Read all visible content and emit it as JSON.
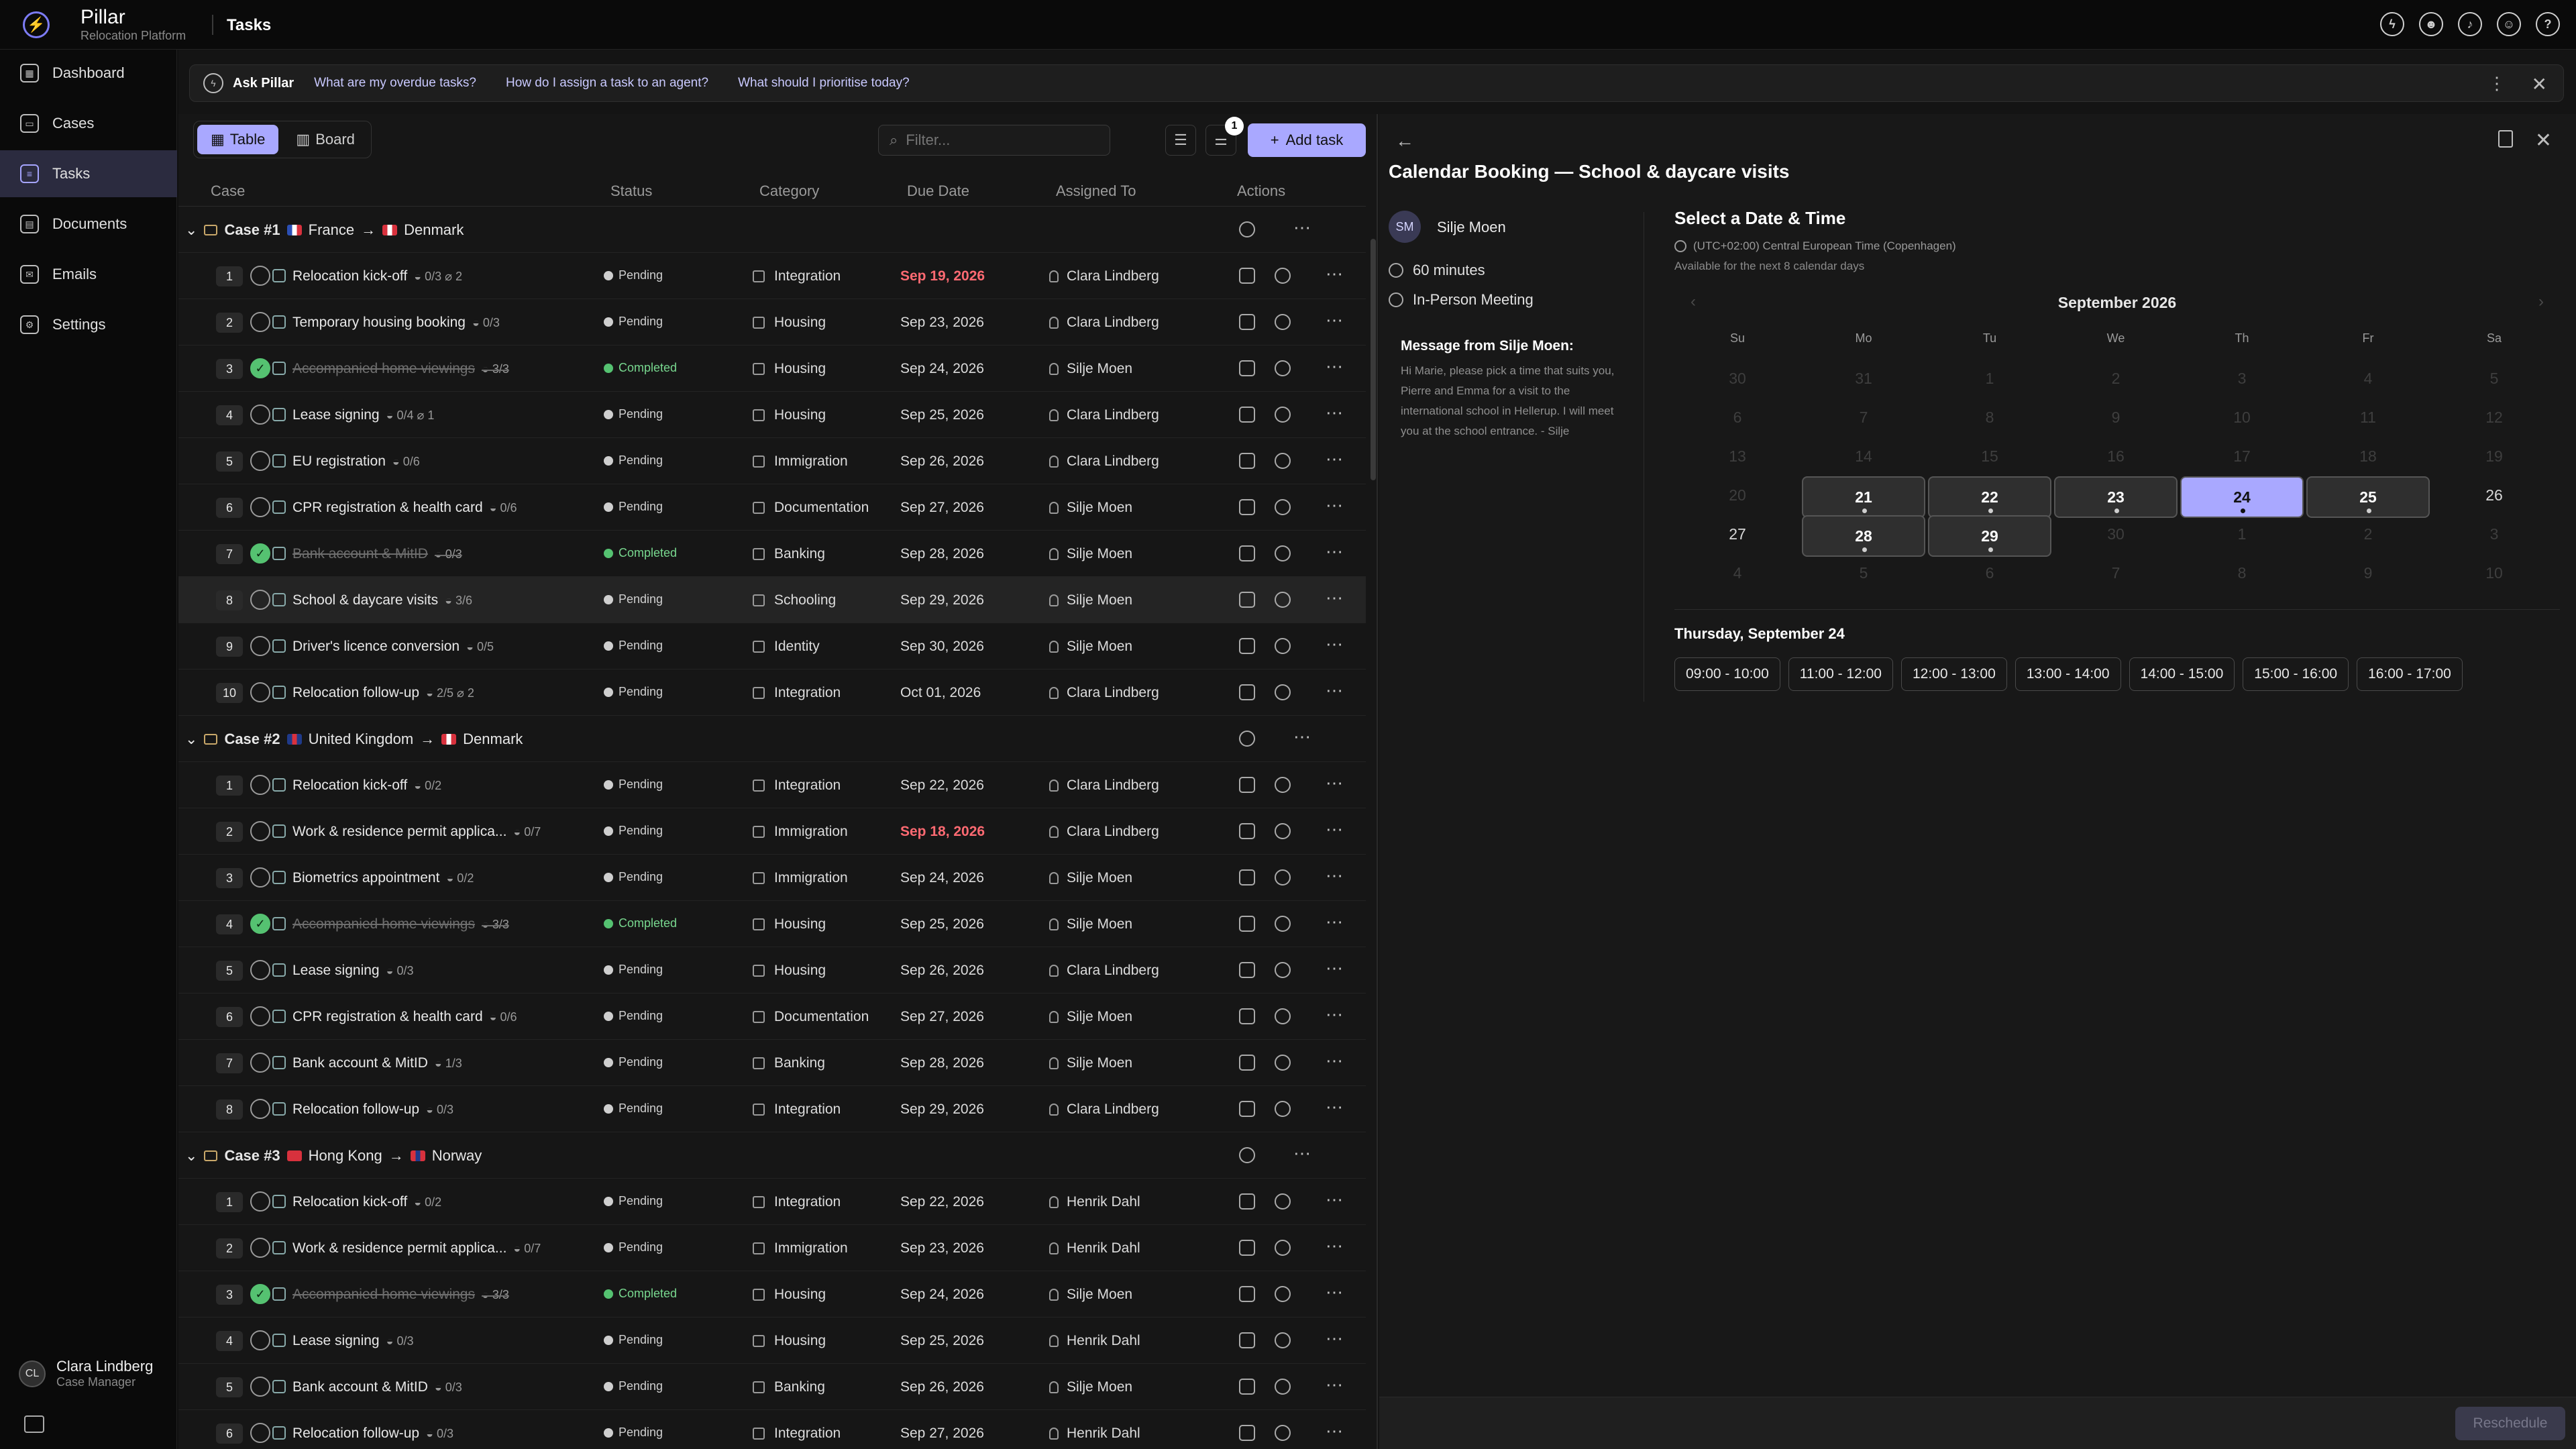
{
  "app": {
    "name": "Pillar",
    "subtitle": "Relocation Platform",
    "page_title": "Tasks"
  },
  "topbar_icons": [
    "bolt-icon",
    "user-gear-icon",
    "bell-icon",
    "smiley-icon",
    "help-icon"
  ],
  "sidebar": {
    "items": [
      {
        "label": "Dashboard",
        "icon": "dashboard-icon"
      },
      {
        "label": "Cases",
        "icon": "briefcase-icon"
      },
      {
        "label": "Tasks",
        "icon": "tasks-icon",
        "active": true
      },
      {
        "label": "Documents",
        "icon": "document-icon"
      },
      {
        "label": "Emails",
        "icon": "mail-icon"
      },
      {
        "label": "Settings",
        "icon": "gear-icon"
      }
    ],
    "user": {
      "initials": "CL",
      "name": "Clara Lindberg",
      "role": "Case Manager"
    }
  },
  "ask": {
    "label": "Ask Pillar",
    "suggestions": [
      "What are my overdue tasks?",
      "How do I assign a task to an agent?",
      "What should I prioritise today?"
    ]
  },
  "toolbar": {
    "table": "Table",
    "board": "Board",
    "filter_placeholder": "Filter...",
    "filter_count": "1",
    "add_task": "Add task"
  },
  "columns": {
    "case": "Case",
    "status": "Status",
    "category": "Category",
    "due": "Due Date",
    "assigned": "Assigned To",
    "actions": "Actions"
  },
  "cases": [
    {
      "label": "Case #1",
      "from": "France",
      "to": "Denmark",
      "from_colors": [
        "#2b4fb5",
        "#ffffff",
        "#d8313d"
      ],
      "to_colors": [
        "#d8313d",
        "#ffffff",
        "#d8313d"
      ],
      "tasks": [
        {
          "n": "1",
          "name": "Relocation kick-off",
          "meta": "◒ 0/3 ⌀ 2",
          "status": "Pending",
          "category": "Integration",
          "due": "Sep 19, 2026",
          "overdue": true,
          "assignee": "Clara Lindberg"
        },
        {
          "n": "2",
          "name": "Temporary housing booking",
          "meta": "◒ 0/3",
          "status": "Pending",
          "category": "Housing",
          "due": "Sep 23, 2026",
          "assignee": "Clara Lindberg"
        },
        {
          "n": "3",
          "name": "Accompanied home viewings",
          "meta": "◒ 3/3",
          "status": "Completed",
          "category": "Housing",
          "due": "Sep 24, 2026",
          "assignee": "Silje Moen",
          "done": true
        },
        {
          "n": "4",
          "name": "Lease signing",
          "meta": "◒ 0/4 ⌀ 1",
          "status": "Pending",
          "category": "Housing",
          "due": "Sep 25, 2026",
          "assignee": "Clara Lindberg"
        },
        {
          "n": "5",
          "name": "EU registration",
          "meta": "◒ 0/6",
          "status": "Pending",
          "category": "Immigration",
          "due": "Sep 26, 2026",
          "assignee": "Clara Lindberg"
        },
        {
          "n": "6",
          "name": "CPR registration & health card",
          "meta": "◒ 0/6",
          "status": "Pending",
          "category": "Documentation",
          "due": "Sep 27, 2026",
          "assignee": "Silje Moen"
        },
        {
          "n": "7",
          "name": "Bank account & MitID",
          "meta": "◒ 0/3",
          "status": "Completed",
          "category": "Banking",
          "due": "Sep 28, 2026",
          "assignee": "Silje Moen",
          "done": true
        },
        {
          "n": "8",
          "name": "School & daycare visits",
          "meta": "◒ 3/6",
          "status": "Pending",
          "category": "Schooling",
          "due": "Sep 29, 2026",
          "assignee": "Silje Moen",
          "selected": true
        },
        {
          "n": "9",
          "name": "Driver's licence conversion",
          "meta": "◒ 0/5",
          "status": "Pending",
          "category": "Identity",
          "due": "Sep 30, 2026",
          "assignee": "Silje Moen"
        },
        {
          "n": "10",
          "name": "Relocation follow-up",
          "meta": "◒ 2/5 ⌀ 2",
          "status": "Pending",
          "category": "Integration",
          "due": "Oct 01, 2026",
          "assignee": "Clara Lindberg"
        }
      ]
    },
    {
      "label": "Case #2",
      "from": "United Kingdom",
      "to": "Denmark",
      "from_colors": [
        "#1f3a8a",
        "#d8313d",
        "#1f3a8a"
      ],
      "to_colors": [
        "#d8313d",
        "#ffffff",
        "#d8313d"
      ],
      "tasks": [
        {
          "n": "1",
          "name": "Relocation kick-off",
          "meta": "◒ 0/2",
          "status": "Pending",
          "category": "Integration",
          "due": "Sep 22, 2026",
          "assignee": "Clara Lindberg"
        },
        {
          "n": "2",
          "name": "Work & residence permit applica...",
          "meta": "◒ 0/7",
          "status": "Pending",
          "category": "Immigration",
          "due": "Sep 18, 2026",
          "overdue": true,
          "assignee": "Clara Lindberg"
        },
        {
          "n": "3",
          "name": "Biometrics appointment",
          "meta": "◒ 0/2",
          "status": "Pending",
          "category": "Immigration",
          "due": "Sep 24, 2026",
          "assignee": "Silje Moen"
        },
        {
          "n": "4",
          "name": "Accompanied home viewings",
          "meta": "◒ 3/3",
          "status": "Completed",
          "category": "Housing",
          "due": "Sep 25, 2026",
          "assignee": "Silje Moen",
          "done": true
        },
        {
          "n": "5",
          "name": "Lease signing",
          "meta": "◒ 0/3",
          "status": "Pending",
          "category": "Housing",
          "due": "Sep 26, 2026",
          "assignee": "Clara Lindberg"
        },
        {
          "n": "6",
          "name": "CPR registration & health card",
          "meta": "◒ 0/6",
          "status": "Pending",
          "category": "Documentation",
          "due": "Sep 27, 2026",
          "assignee": "Silje Moen"
        },
        {
          "n": "7",
          "name": "Bank account & MitID",
          "meta": "◒ 1/3",
          "status": "Pending",
          "category": "Banking",
          "due": "Sep 28, 2026",
          "assignee": "Silje Moen"
        },
        {
          "n": "8",
          "name": "Relocation follow-up",
          "meta": "◒ 0/3",
          "status": "Pending",
          "category": "Integration",
          "due": "Sep 29, 2026",
          "assignee": "Clara Lindberg"
        }
      ]
    },
    {
      "label": "Case #3",
      "from": "Hong Kong",
      "to": "Norway",
      "from_colors": [
        "#d8313d",
        "#d8313d",
        "#d8313d"
      ],
      "to_colors": [
        "#d8313d",
        "#1f3a8a",
        "#d8313d"
      ],
      "tasks": [
        {
          "n": "1",
          "name": "Relocation kick-off",
          "meta": "◒ 0/2",
          "status": "Pending",
          "category": "Integration",
          "due": "Sep 22, 2026",
          "assignee": "Henrik Dahl"
        },
        {
          "n": "2",
          "name": "Work & residence permit applica...",
          "meta": "◒ 0/7",
          "status": "Pending",
          "category": "Immigration",
          "due": "Sep 23, 2026",
          "assignee": "Henrik Dahl"
        },
        {
          "n": "3",
          "name": "Accompanied home viewings",
          "meta": "◒ 3/3",
          "status": "Completed",
          "category": "Housing",
          "due": "Sep 24, 2026",
          "assignee": "Silje Moen",
          "done": true
        },
        {
          "n": "4",
          "name": "Lease signing",
          "meta": "◒ 0/3",
          "status": "Pending",
          "category": "Housing",
          "due": "Sep 25, 2026",
          "assignee": "Henrik Dahl"
        },
        {
          "n": "5",
          "name": "Bank account & MitID",
          "meta": "◒ 0/3",
          "status": "Pending",
          "category": "Banking",
          "due": "Sep 26, 2026",
          "assignee": "Silje Moen"
        },
        {
          "n": "6",
          "name": "Relocation follow-up",
          "meta": "◒ 0/3",
          "status": "Pending",
          "category": "Integration",
          "due": "Sep 27, 2026",
          "assignee": "Henrik Dahl"
        }
      ]
    }
  ],
  "booking": {
    "title": "Calendar Booking — School & daycare visits",
    "organizer_initials": "SM",
    "organizer": "Silje Moen",
    "duration": "60 minutes",
    "meeting_type": "In-Person Meeting",
    "message_heading": "Message from Silje Moen:",
    "message": "Hi Marie, please pick a time that suits you, Pierre and Emma for a visit to the international school in Hellerup. I will meet you at the school entrance. - Silje",
    "select_heading": "Select a Date & Time",
    "timezone": "(UTC+02:00) Central European Time (Copenhagen)",
    "availability": "Available for the next 8 calendar days",
    "month": "September 2026",
    "weekdays": [
      "Su",
      "Mo",
      "Tu",
      "We",
      "Th",
      "Fr",
      "Sa"
    ],
    "weeks": [
      [
        "30",
        "31",
        "1",
        "2",
        "3",
        "4",
        "5"
      ],
      [
        "6",
        "7",
        "8",
        "9",
        "10",
        "11",
        "12"
      ],
      [
        "13",
        "14",
        "15",
        "16",
        "17",
        "18",
        "19"
      ],
      [
        "20",
        "21",
        "22",
        "23",
        "24",
        "25",
        "26"
      ],
      [
        "27",
        "28",
        "29",
        "30",
        "1",
        "2",
        "3"
      ],
      [
        "4",
        "5",
        "6",
        "7",
        "8",
        "9",
        "10"
      ]
    ],
    "available": [
      "21",
      "22",
      "23",
      "24",
      "25",
      "28",
      "29"
    ],
    "current_other": [
      "26",
      "27"
    ],
    "selected": "24",
    "selected_label": "Thursday, September 24",
    "slots": [
      "09:00 - 10:00",
      "11:00 - 12:00",
      "12:00 - 13:00",
      "13:00 - 14:00",
      "14:00 - 15:00",
      "15:00 - 16:00",
      "16:00 - 17:00"
    ],
    "reschedule": "Reschedule"
  }
}
